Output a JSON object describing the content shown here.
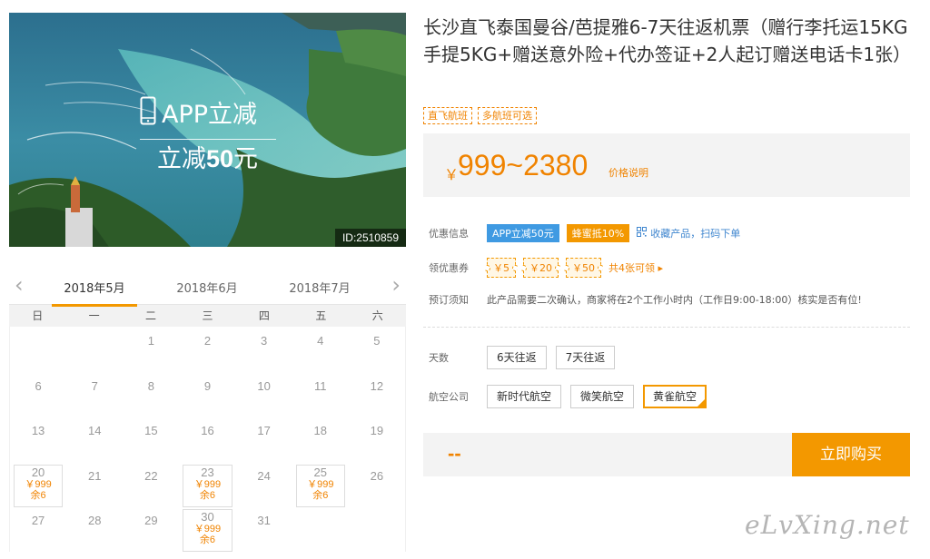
{
  "hero": {
    "promo_line1": "APP立减",
    "promo_line2_prefix": "立减",
    "promo_line2_amount": "50",
    "promo_line2_suffix": "元",
    "image_id": "ID:2510859",
    "icon": "phone-icon"
  },
  "calendar": {
    "prev_icon": "chevron-left-icon",
    "next_icon": "chevron-right-icon",
    "months": [
      "2018年5月",
      "2018年6月",
      "2018年7月"
    ],
    "active_month": 0,
    "weekdays": [
      "日",
      "一",
      "二",
      "三",
      "四",
      "五",
      "六"
    ],
    "weeks": [
      [
        {
          "d": ""
        },
        {
          "d": ""
        },
        {
          "d": "1"
        },
        {
          "d": "2"
        },
        {
          "d": "3"
        },
        {
          "d": "4"
        },
        {
          "d": "5"
        }
      ],
      [
        {
          "d": "6"
        },
        {
          "d": "7"
        },
        {
          "d": "8"
        },
        {
          "d": "9"
        },
        {
          "d": "10"
        },
        {
          "d": "11"
        },
        {
          "d": "12"
        }
      ],
      [
        {
          "d": "13"
        },
        {
          "d": "14"
        },
        {
          "d": "15"
        },
        {
          "d": "16"
        },
        {
          "d": "17"
        },
        {
          "d": "18"
        },
        {
          "d": "19"
        }
      ],
      [
        {
          "d": "20",
          "price": "￥999",
          "left": "余6"
        },
        {
          "d": "21"
        },
        {
          "d": "22"
        },
        {
          "d": "23",
          "price": "￥999",
          "left": "余6"
        },
        {
          "d": "24"
        },
        {
          "d": "25",
          "price": "￥999",
          "left": "余6"
        },
        {
          "d": "26"
        }
      ],
      [
        {
          "d": "27"
        },
        {
          "d": "28"
        },
        {
          "d": "29"
        },
        {
          "d": "30",
          "price": "￥999",
          "left": "余6"
        },
        {
          "d": "31"
        },
        {
          "d": ""
        },
        {
          "d": ""
        }
      ]
    ]
  },
  "product": {
    "title": "长沙直飞泰国曼谷/芭提雅6-7天往返机票（赠行李托运15KG手提5KG+赠送意外险+代办签证+2人起订赠送电话卡1张）",
    "tags": [
      "直飞航班",
      "多航班可选"
    ],
    "currency": "￥",
    "price": "999~2380",
    "price_note": "价格说明"
  },
  "offers": {
    "label": "优惠信息",
    "badge_app": "APP立减50元",
    "badge_honey": "蜂蜜抵10%",
    "qr_icon": "qr-code-icon",
    "qr_text": "收藏产品，扫码下单"
  },
  "coupons": {
    "label": "领优惠券",
    "items": [
      "￥5",
      "￥20",
      "￥50"
    ],
    "more": "共4张可领 ▸"
  },
  "booking": {
    "label": "预订须知",
    "text": "此产品需要二次确认，商家将在2个工作小时内（工作日9:00-18:00）核实是否有位!"
  },
  "days": {
    "label": "天数",
    "options": [
      "6天往返",
      "7天往返"
    ],
    "selected": -1
  },
  "airline": {
    "label": "航空公司",
    "options": [
      "新时代航空",
      "微笑航空",
      "黄雀航空"
    ],
    "selected": 2
  },
  "buy": {
    "dash": "--",
    "button": "立即购买"
  },
  "watermark": "eLvXing.net",
  "colors": {
    "accent": "#f39800",
    "price": "#f08300",
    "blue_badge": "#3f9ae2",
    "link": "#3f86cf"
  }
}
